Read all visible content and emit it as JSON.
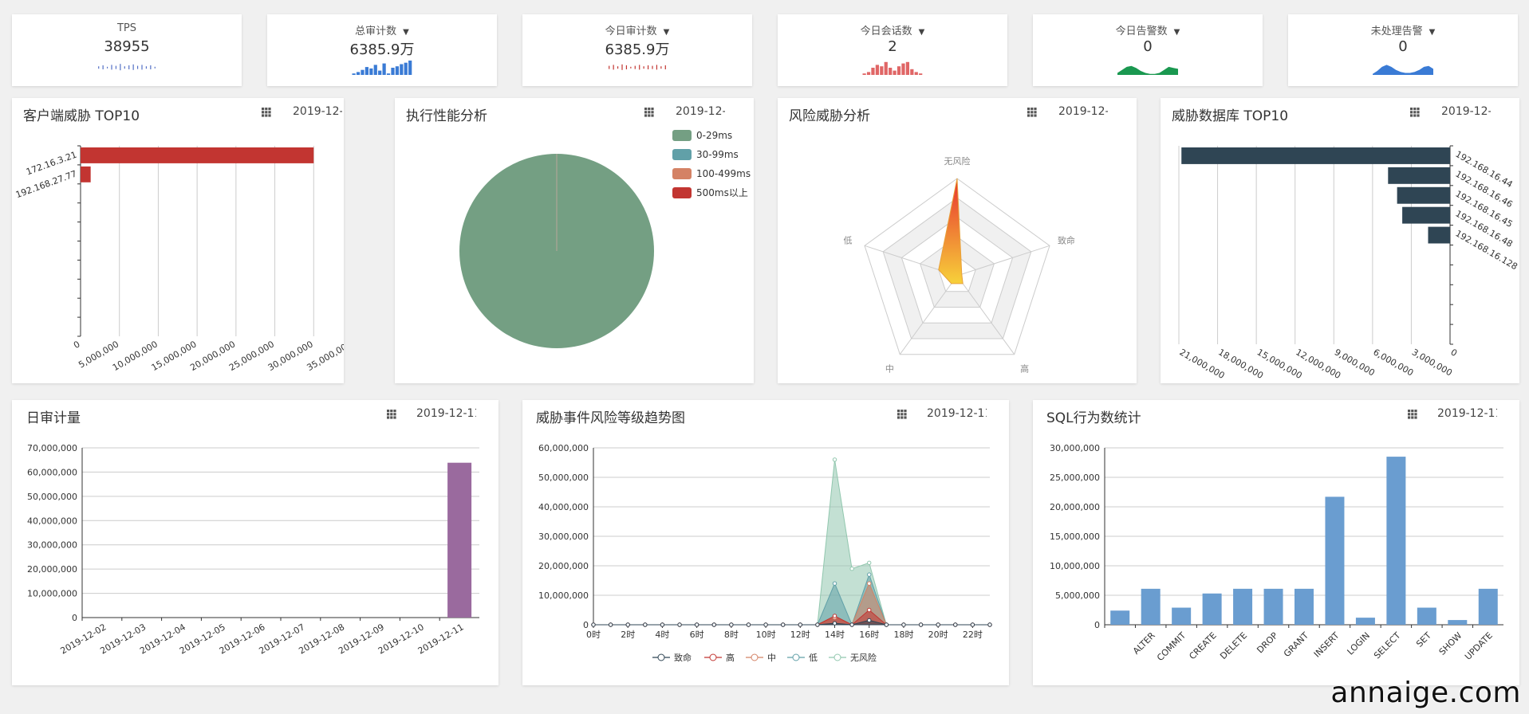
{
  "stats": [
    {
      "label": "TPS",
      "value": "38955",
      "caret": "",
      "color": "#5470c6",
      "kind": "line"
    },
    {
      "label": "总审计数",
      "value": "6385.9万",
      "caret": "▼",
      "color": "#3a7bd5",
      "kind": "bars"
    },
    {
      "label": "今日审计数",
      "value": "6385.9万",
      "caret": "▼",
      "color": "#c23531",
      "kind": "line"
    },
    {
      "label": "今日会话数",
      "value": "2",
      "caret": "▼",
      "color": "#e06666",
      "kind": "bars"
    },
    {
      "label": "今日告警数",
      "value": "0",
      "caret": "▼",
      "color": "#1a9850",
      "kind": "area"
    },
    {
      "label": "未处理告警",
      "value": "0",
      "caret": "▼",
      "color": "#3a7bd5",
      "kind": "area"
    }
  ],
  "panels": {
    "client_top10": {
      "title": "客户端威胁 TOP10",
      "date": "2019-12-11"
    },
    "performance": {
      "title": "执行性能分析",
      "date": "2019-12-11"
    },
    "risk": {
      "title": "风险威胁分析",
      "date": "2019-12-11"
    },
    "db_top10": {
      "title": "威胁数据库 TOP10",
      "date": "2019-12-11"
    },
    "daily": {
      "title": "日审计量",
      "date": "2019-12-11"
    },
    "trend": {
      "title": "威胁事件风险等级趋势图",
      "date": "2019-12-11"
    },
    "sql": {
      "title": "SQL行为数统计",
      "date": "2019-12-11"
    }
  },
  "watermark": "annaige.com",
  "chart_data": [
    {
      "id": "client_top10",
      "type": "bar",
      "orientation": "horizontal",
      "categories": [
        "172.16.3.21",
        "192.168.27.77"
      ],
      "values": [
        30000000,
        1300000
      ],
      "color": "#c23531",
      "xlim": [
        0,
        35000000
      ],
      "xticks": [
        "0",
        "5,000,000",
        "10,000,000",
        "15,000,000",
        "20,000,000",
        "25,000,000",
        "30,000,000",
        "35,000,000"
      ]
    },
    {
      "id": "performance",
      "type": "pie",
      "categories": [
        "0-29ms",
        "30-99ms",
        "100-499ms",
        "500ms以上"
      ],
      "values": [
        100,
        0,
        0,
        0
      ],
      "colors": [
        "#749f83",
        "#61a0a8",
        "#d48265",
        "#c23531"
      ]
    },
    {
      "id": "risk",
      "type": "radar",
      "indicators": [
        "无风险",
        "致命",
        "高",
        "中",
        "低"
      ],
      "values": [
        1.0,
        0.05,
        0.1,
        0.1,
        0.2
      ]
    },
    {
      "id": "db_top10",
      "type": "bar",
      "orientation": "horizontal",
      "x_inverse": true,
      "categories": [
        "192.168.16.44",
        "192.168.16.46",
        "192.168.16.45",
        "192.168.16.48",
        "192.168.16.128"
      ],
      "values": [
        20800000,
        4800000,
        4100000,
        3700000,
        1700000
      ],
      "color": "#2f4554",
      "xlim": [
        0,
        21000000
      ],
      "xticks": [
        "0",
        "3,000,000",
        "6,000,000",
        "9,000,000",
        "12,000,000",
        "15,000,000",
        "18,000,000",
        "21,000,000"
      ]
    },
    {
      "id": "daily",
      "type": "bar",
      "categories": [
        "2019-12-02",
        "2019-12-03",
        "2019-12-04",
        "2019-12-05",
        "2019-12-06",
        "2019-12-07",
        "2019-12-08",
        "2019-12-09",
        "2019-12-10",
        "2019-12-11"
      ],
      "values": [
        0,
        0,
        0,
        0,
        0,
        0,
        0,
        0,
        0,
        63859000
      ],
      "color": "#9a6a9e",
      "ylim": [
        0,
        70000000
      ],
      "yticks": [
        "0",
        "10,000,000",
        "20,000,000",
        "30,000,000",
        "40,000,000",
        "50,000,000",
        "60,000,000",
        "70,000,000"
      ]
    },
    {
      "id": "trend",
      "type": "area",
      "x": [
        "0时",
        "1时",
        "2时",
        "3时",
        "4时",
        "5时",
        "6时",
        "7时",
        "8时",
        "9时",
        "10时",
        "11时",
        "12时",
        "13时",
        "14时",
        "15时",
        "16时",
        "17时",
        "18时",
        "19时",
        "20时",
        "21时",
        "22时",
        "23时"
      ],
      "xtick_labels": [
        "0时",
        "2时",
        "4时",
        "6时",
        "8时",
        "10时",
        "12时",
        "14时",
        "16时",
        "18时",
        "20时",
        "22时"
      ],
      "series": [
        {
          "name": "致命",
          "color": "#2f4554",
          "values": [
            0,
            0,
            0,
            0,
            0,
            0,
            0,
            0,
            0,
            0,
            0,
            0,
            0,
            0,
            500000,
            0,
            1500000,
            0,
            0,
            0,
            0,
            0,
            0,
            0
          ]
        },
        {
          "name": "高",
          "color": "#c23531",
          "values": [
            0,
            0,
            0,
            0,
            0,
            0,
            0,
            0,
            0,
            0,
            0,
            0,
            0,
            0,
            3000000,
            0,
            5000000,
            0,
            0,
            0,
            0,
            0,
            0,
            0
          ]
        },
        {
          "name": "中",
          "color": "#d48265",
          "values": [
            0,
            0,
            0,
            0,
            0,
            0,
            0,
            0,
            0,
            0,
            0,
            0,
            0,
            0,
            2500000,
            0,
            14000000,
            0,
            0,
            0,
            0,
            0,
            0,
            0
          ]
        },
        {
          "name": "低",
          "color": "#61a0a8",
          "values": [
            0,
            0,
            0,
            0,
            0,
            0,
            0,
            0,
            0,
            0,
            0,
            0,
            0,
            0,
            14000000,
            0,
            17000000,
            0,
            0,
            0,
            0,
            0,
            0,
            0
          ]
        },
        {
          "name": "无风险",
          "color": "#91c7ae",
          "values": [
            0,
            0,
            0,
            0,
            0,
            0,
            0,
            0,
            0,
            0,
            0,
            0,
            0,
            0,
            56000000,
            19000000,
            21000000,
            0,
            0,
            0,
            0,
            0,
            0,
            0
          ]
        }
      ],
      "ylim": [
        0,
        60000000
      ],
      "yticks": [
        "0",
        "10,000,000",
        "20,000,000",
        "30,000,000",
        "40,000,000",
        "50,000,000",
        "60,000,000"
      ]
    },
    {
      "id": "sql",
      "type": "bar",
      "categories": [
        "",
        "ALTER",
        "COMMIT",
        "CREATE",
        "DELETE",
        "DROP",
        "GRANT",
        "INSERT",
        "LOGIN",
        "SELECT",
        "SET",
        "SHOW",
        "UPDATE"
      ],
      "values": [
        2400000,
        6100000,
        2900000,
        5300000,
        6100000,
        6100000,
        6100000,
        21700000,
        1200000,
        28500000,
        2900000,
        800000,
        6100000
      ],
      "color": "#6a9dd0",
      "ylim": [
        0,
        30000000
      ],
      "yticks": [
        "0",
        "5,000,000",
        "10,000,000",
        "15,000,000",
        "20,000,000",
        "25,000,000",
        "30,000,000"
      ]
    }
  ]
}
